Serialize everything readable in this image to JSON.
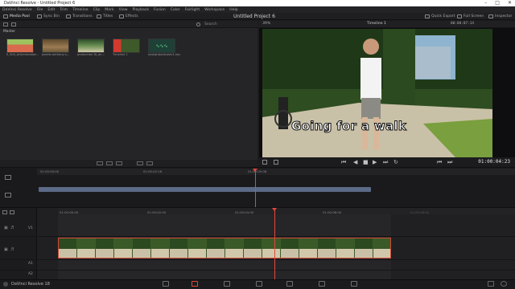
{
  "window": {
    "title": "DaVinci Resolve - Untitled Project 6",
    "project_title": "Untitled Project 6"
  },
  "menu": [
    "DaVinci Resolve",
    "File",
    "Edit",
    "Trim",
    "Timeline",
    "Clip",
    "Mark",
    "View",
    "Playback",
    "Fusion",
    "Color",
    "Fairlight",
    "Workspace",
    "Help"
  ],
  "toolbar": {
    "media_pool": "Media Pool",
    "sync_bin": "Sync Bin",
    "transitions": "Transitions",
    "titles": "Titles",
    "effects": "Effects",
    "quick_export": "Quick Export",
    "full_screen": "Full Screen",
    "inspector": "Inspector"
  },
  "media_pool": {
    "search_label": "Search",
    "bin_name": "Master",
    "clips": [
      {
        "label": "0_Still_Art/Intimation..."
      },
      {
        "label": "pexels-anthony-s..."
      },
      {
        "label": "production ID_an..."
      },
      {
        "label": "Timeline 1"
      },
      {
        "label": "lowlightpodcastv1.mp4"
      }
    ]
  },
  "viewer": {
    "zoom": "39%",
    "timeline_name": "Timeline 1",
    "source_tc": "00:00:07:14",
    "timecode": "01:00:04:23",
    "caption": "Going for a walk"
  },
  "timeline": {
    "mini_ruler_ticks": [
      "01:00:00:00",
      "01:00:02:16",
      "01:00:05:08"
    ],
    "main_ruler_ticks": [
      "01:00:00:00",
      "01:00:02:00",
      "01:00:04:00",
      "01:00:06:00",
      "01:00:08:00"
    ],
    "tracks": [
      "V1",
      "A1",
      "A2"
    ]
  },
  "bottom_bar": {
    "app_name": "DaVinci Resolve 18"
  },
  "colors": {
    "playhead": "#e2473b",
    "mini_clip": "#5b6a87",
    "clip_border": "#d24a35"
  }
}
